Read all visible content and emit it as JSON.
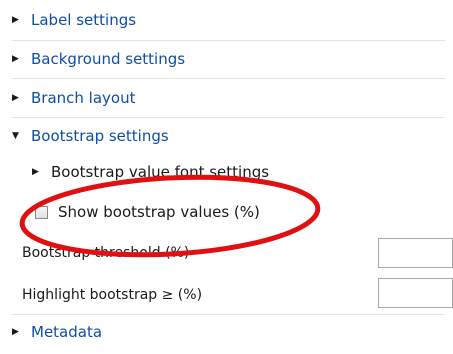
{
  "sections": {
    "label_settings": "Label settings",
    "background_settings": "Background settings",
    "branch_layout": "Branch layout",
    "bootstrap_settings": "Bootstrap settings",
    "bootstrap_font_settings": "Bootstrap value font settings",
    "metadata": "Metadata"
  },
  "bootstrap": {
    "show_values_label": "Show bootstrap values (%)",
    "show_values_checked": false,
    "threshold_label": "Bootstrap threshold (%)",
    "threshold_value": "",
    "highlight_label": "Highlight bootstrap ≥ (%)",
    "highlight_value": ""
  },
  "icons": {
    "collapsed": "triangle-right-icon",
    "expanded": "triangle-down-icon"
  },
  "colors": {
    "link": "#0f4fa8",
    "annotation": "#e01010"
  }
}
